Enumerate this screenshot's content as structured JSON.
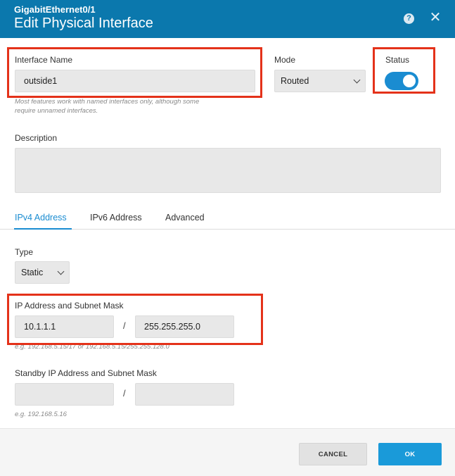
{
  "header": {
    "interface_id": "GigabitEthernet0/1",
    "title": "Edit Physical Interface",
    "help_icon": "question-circle-icon",
    "close_icon": "close-icon"
  },
  "interface_name": {
    "label": "Interface Name",
    "value": "outside1",
    "hint_line1": "Most features work with named interfaces only, although some",
    "hint_line2": "require unnamed interfaces."
  },
  "mode": {
    "label": "Mode",
    "selected": "Routed"
  },
  "status": {
    "label": "Status",
    "enabled": true
  },
  "description": {
    "label": "Description",
    "value": ""
  },
  "tabs": [
    {
      "label": "IPv4 Address",
      "active": true
    },
    {
      "label": "IPv6 Address",
      "active": false
    },
    {
      "label": "Advanced",
      "active": false
    }
  ],
  "type": {
    "label": "Type",
    "selected": "Static"
  },
  "ip": {
    "label": "IP Address and Subnet Mask",
    "address": "10.1.1.1",
    "separator": "/",
    "mask": "255.255.255.0",
    "hint": "e.g. 192.168.5.15/17 or 192.168.5.15/255.255.128.0"
  },
  "standby": {
    "label": "Standby IP Address and Subnet Mask",
    "address": "",
    "separator": "/",
    "mask": "",
    "hint": "e.g. 192.168.5.16"
  },
  "footer": {
    "cancel_label": "CANCEL",
    "ok_label": "OK"
  },
  "colors": {
    "header_bg": "#0b78ad",
    "accent": "#1a8cd1",
    "highlight_box": "#e4321a",
    "ok_button": "#1a9ad9"
  }
}
